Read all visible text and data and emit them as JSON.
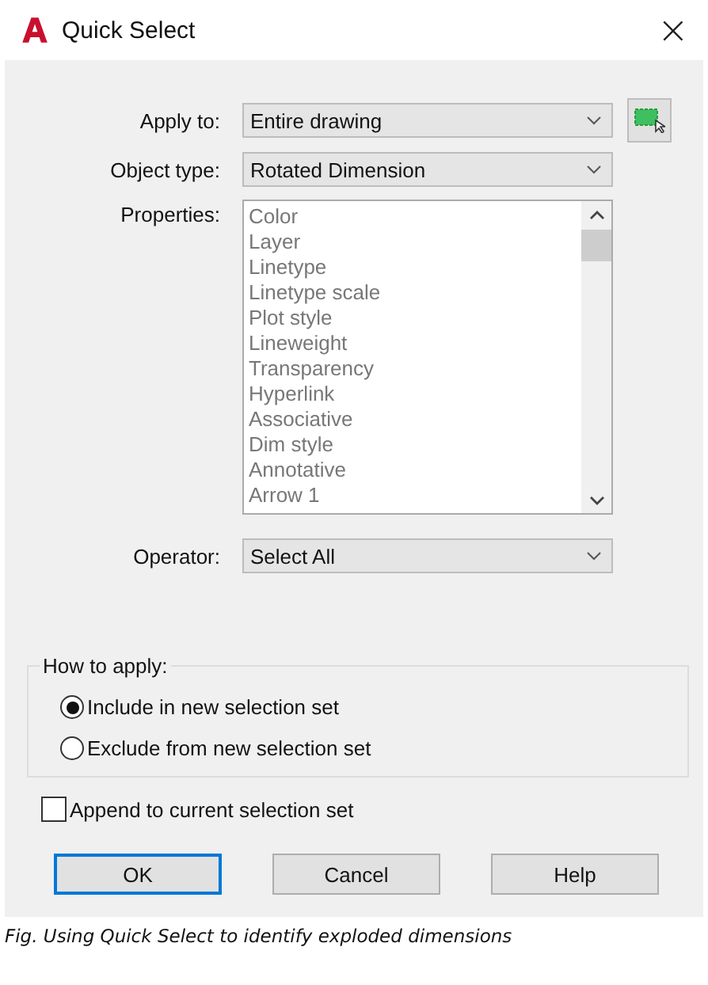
{
  "window": {
    "title": "Quick Select",
    "close": "×"
  },
  "apply_to": {
    "label": "Apply to:",
    "value": "Entire drawing"
  },
  "object_type": {
    "label": "Object type:",
    "value": "Rotated Dimension"
  },
  "properties": {
    "label": "Properties:",
    "items": [
      {
        "label": "Color"
      },
      {
        "label": "Layer"
      },
      {
        "label": "Linetype"
      },
      {
        "label": "Linetype scale"
      },
      {
        "label": "Plot style"
      },
      {
        "label": "Lineweight"
      },
      {
        "label": "Transparency"
      },
      {
        "label": "Hyperlink"
      },
      {
        "label": "Associative"
      },
      {
        "label": "Dim style"
      },
      {
        "label": "Annotative"
      },
      {
        "label": "Arrow 1"
      }
    ]
  },
  "operator": {
    "label": "Operator:",
    "value": "Select All"
  },
  "how_to_apply": {
    "title": "How to apply:",
    "options": [
      {
        "label": "Include in new selection set",
        "selected": true
      },
      {
        "label": "Exclude from new selection set",
        "selected": false
      }
    ]
  },
  "append": {
    "label": "Append to current selection set",
    "checked": false
  },
  "buttons": [
    {
      "label": "OK",
      "default": true
    },
    {
      "label": "Cancel",
      "default": false
    },
    {
      "label": "Help",
      "default": false
    }
  ],
  "caption": "Fig. Using Quick Select to identify exploded dimensions"
}
